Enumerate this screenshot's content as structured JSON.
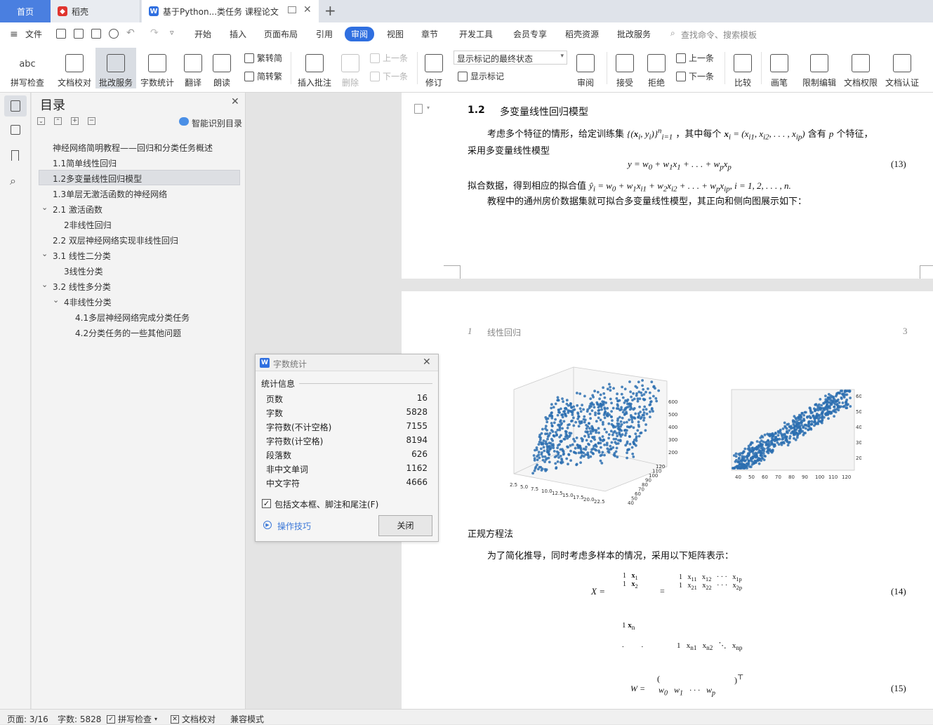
{
  "tabs": {
    "home": "首页",
    "daoke": "稻壳",
    "doc": "基于Python...类任务 课程论文",
    "add_icon": "plus-icon"
  },
  "menubar": {
    "file": "文件",
    "items": [
      "开始",
      "插入",
      "页面布局",
      "引用",
      "审阅",
      "视图",
      "章节",
      "开发工具",
      "会员专享",
      "稻壳资源",
      "批改服务"
    ],
    "active": "审阅",
    "search_placeholder": "查找命令、搜索模板"
  },
  "ribbon": {
    "spellcheck": "拼写检查",
    "doccheck": "文档校对",
    "review_service": "批改服务",
    "wordcount": "字数统计",
    "translate": "翻译",
    "read_aloud": "朗读",
    "trad": "繁转简",
    "simp": "简转繁",
    "insert_comment": "插入批注",
    "delete": "删除",
    "prev": "上一条",
    "next": "下一条",
    "track": "修订",
    "markup_state": "显示标记的最终状态",
    "show_markup": "显示标记",
    "review": "审阅",
    "accept": "接受",
    "reject": "拒绝",
    "prev2": "上一条",
    "next2": "下一条",
    "compare": "比较",
    "pen": "画笔",
    "restrict": "限制编辑",
    "rights": "文档权限",
    "certify": "文档认证"
  },
  "toc": {
    "title": "目录",
    "smart": "智能识别目录",
    "items": [
      "神经网络简明教程——回归和分类任务概述",
      "1.1简单线性回归",
      "1.2多变量线性回归模型",
      "1.3单层无激活函数的神经网络",
      "2.1 激活函数",
      "2非线性回归",
      "2.2 双层神经网络实现非线性回归",
      "3.1 线性二分类",
      "3线性分类",
      "3.2 线性多分类",
      "4非线性分类",
      "4.1多层神经网络完成分类任务",
      "4.2分类任务的一些其他问题"
    ]
  },
  "page1": {
    "heading_num": "1.2",
    "heading": "多变量线性回归模型",
    "p1a": "考虑多个特征的情形，给定训练集",
    "p1b": "，其中每个",
    "p1c": "含有",
    "p1d": "个特征，",
    "p1e": "采用多变量线性模型",
    "eq13": "(13)",
    "p2a": "拟合数据，得到相应的拟合值",
    "p3": "教程中的通州房价数据集就可拟合多变量线性模型，其正向和侧向图展示如下："
  },
  "page2": {
    "header_num": "1",
    "header_title": "线性回归",
    "page_no": "3",
    "section": "正规方程法",
    "p1": "为了简化推导，同时考虑多样本的情况，采用以下矩阵表示：",
    "eq14": "(14)",
    "eq15": "(15)"
  },
  "chart_left": {
    "z_ticks": [
      "600",
      "500",
      "400",
      "300",
      "200"
    ],
    "x_ticks": [
      "2.5",
      "5.0",
      "7.5",
      "10.0",
      "12.5",
      "15.0",
      "17.5",
      "20.0",
      "22.5"
    ],
    "y_ticks": [
      "120",
      "110",
      "100",
      "90",
      "80",
      "70",
      "60",
      "50",
      "40"
    ]
  },
  "chart_right": {
    "z_ticks": [
      "600",
      "500",
      "400",
      "300",
      "200"
    ],
    "x_ticks": [
      "40",
      "50",
      "60",
      "70",
      "80",
      "90",
      "100",
      "110",
      "120"
    ]
  },
  "dialog": {
    "title": "字数统计",
    "section": "统计信息",
    "rows": [
      {
        "label": "页数",
        "value": "16"
      },
      {
        "label": "字数",
        "value": "5828"
      },
      {
        "label": "字符数(不计空格)",
        "value": "7155"
      },
      {
        "label": "字符数(计空格)",
        "value": "8194"
      },
      {
        "label": "段落数",
        "value": "626"
      },
      {
        "label": "非中文单词",
        "value": "1162"
      },
      {
        "label": "中文字符",
        "value": "4666"
      }
    ],
    "checkbox": "包括文本框、脚注和尾注(F)",
    "tips": "操作技巧",
    "close": "关闭"
  },
  "status": {
    "page": "页面: 3/16",
    "words": "字数: 5828",
    "spell": "拼写检查",
    "doccheck": "文档校对",
    "compat": "兼容模式"
  },
  "colors": {
    "accent": "#2f6fe0",
    "tab_home": "#4a7fe0",
    "scatter": "#2b6fb0"
  }
}
